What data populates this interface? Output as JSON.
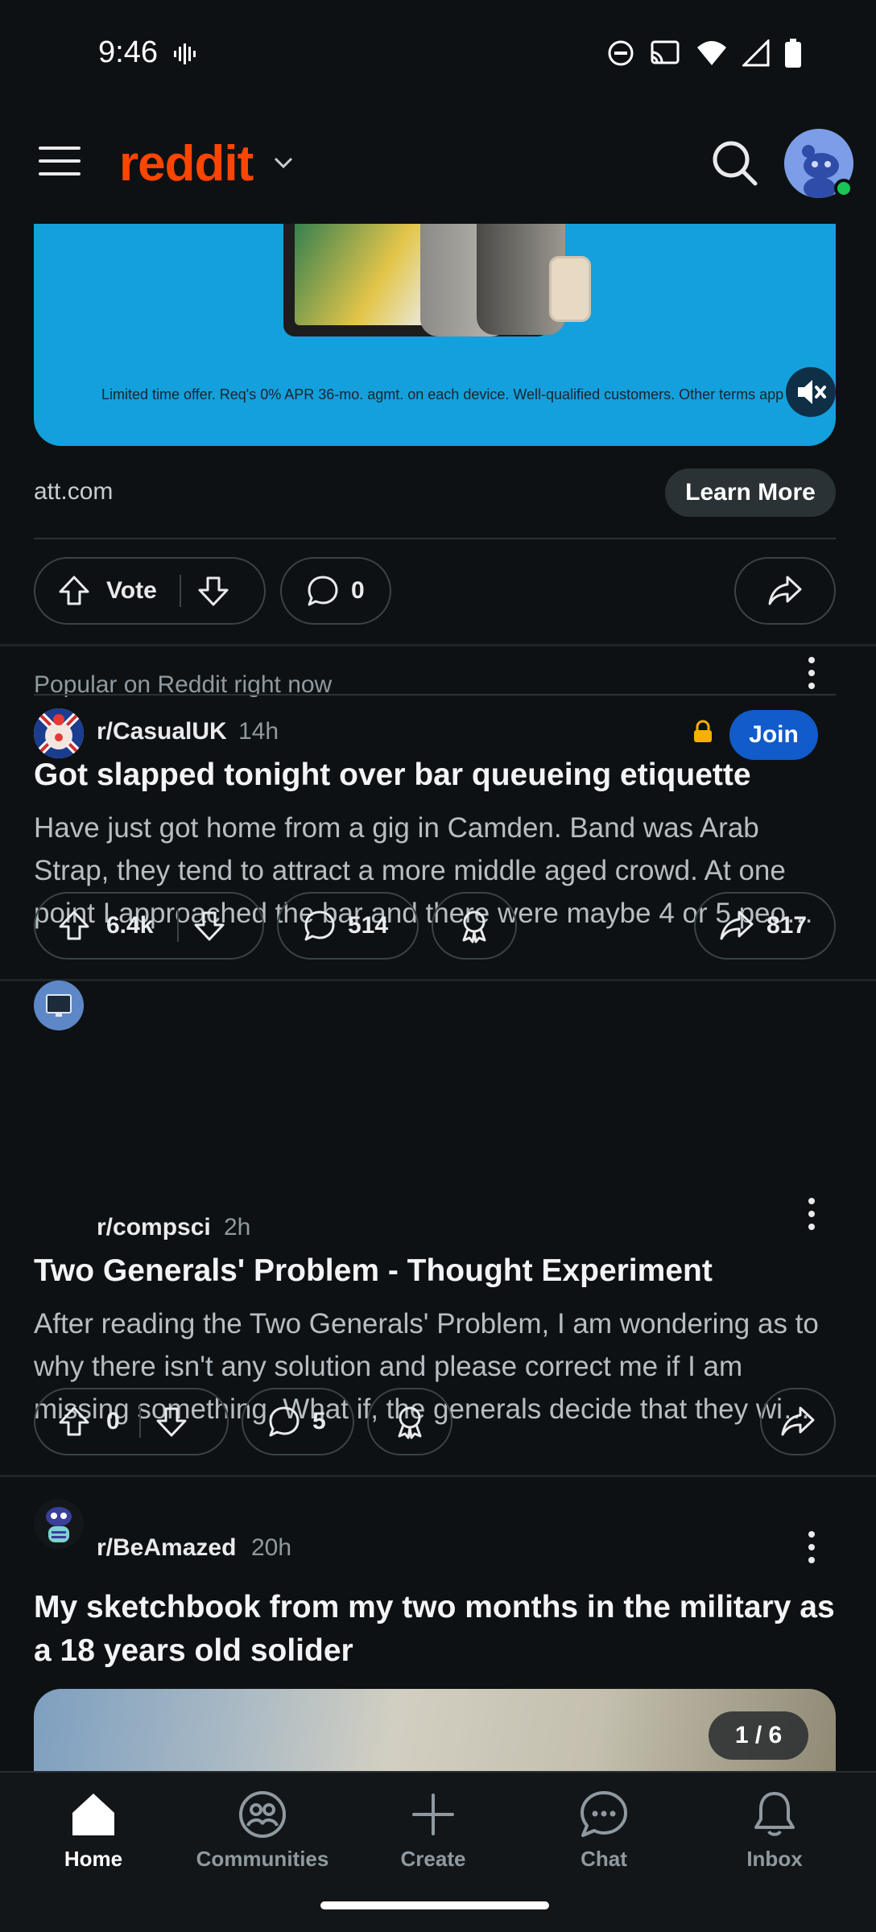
{
  "status_bar": {
    "time": "9:46"
  },
  "header": {
    "brand": "reddit"
  },
  "ad": {
    "disclaimer": "Limited time offer. Req's 0% APR 36-mo. agmt. on each device. Well-qualified customers. Other terms app",
    "source": "att.com",
    "cta_label": "Learn More",
    "vote_label": "Vote",
    "comment_count": "0"
  },
  "section": {
    "label": "Popular on Reddit right now"
  },
  "posts": [
    {
      "subreddit": "r/CasualUK",
      "age": "14h",
      "join_label": "Join",
      "title": "Got slapped tonight over bar queueing etiquette",
      "body": "Have just got home from a gig in Camden. Band was Arab Strap, they tend to attract a more middle aged crowd. At one point I approached the bar and there were maybe 4 or 5 peo…",
      "votes": "6.4k",
      "comments": "514",
      "shares": "817"
    },
    {
      "subreddit": "r/compsci",
      "age": "2h",
      "title": "Two Generals' Problem - Thought Experiment",
      "body": "After reading the Two Generals' Problem, I am wondering as to why there isn't any solution and please correct me if I am missing something. What if, the generals decide that they wi…",
      "votes": "0",
      "comments": "5"
    },
    {
      "subreddit": "r/BeAmazed",
      "age": "20h",
      "title": "My sketchbook from my two months in the military as a 18 years old solider",
      "gallery_count": "1 / 6"
    }
  ],
  "bottom_nav": [
    {
      "label": "Home",
      "icon": "home-icon",
      "active": true
    },
    {
      "label": "Communities",
      "icon": "communities-icon",
      "active": false
    },
    {
      "label": "Create",
      "icon": "plus-icon",
      "active": false
    },
    {
      "label": "Chat",
      "icon": "chat-icon",
      "active": false
    },
    {
      "label": "Inbox",
      "icon": "bell-icon",
      "active": false
    }
  ],
  "colors": {
    "brand": "#ff4500",
    "background": "#0e1113",
    "join": "#115bca",
    "ad_banner": "#14a0dc"
  }
}
